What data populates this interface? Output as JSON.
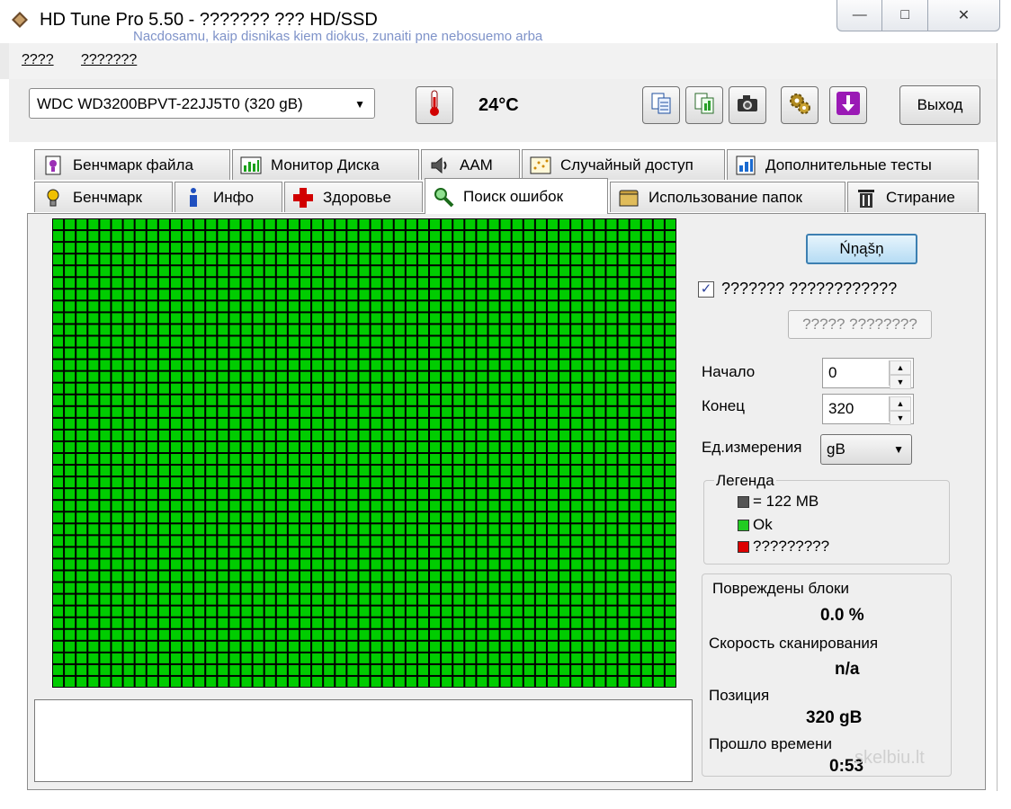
{
  "window": {
    "title": "HD Tune Pro 5.50 - ??????? ??? HD/SSD",
    "background_text": "Nacdosamu, kaip disnikas kiem diokus, zunaiti pne nebosuemo arba",
    "controls": {
      "minimize": "—",
      "maximize": "□",
      "close": "✕"
    }
  },
  "menu": {
    "items": [
      {
        "label": "????"
      },
      {
        "label": "???????"
      }
    ]
  },
  "toolbar": {
    "drive": "WDC WD3200BPVT-22JJ5T0 (320 gB)",
    "temperature": "24°C",
    "exit_label": "Выход",
    "icons": [
      "thermometer-icon",
      "copy-text-icon",
      "copy-info-icon",
      "screenshot-camera-icon",
      "options-gear-icon",
      "save-download-icon"
    ]
  },
  "tabs": {
    "row1": [
      {
        "label": "Бенчмарк файла",
        "icon": "file-benchmark-icon"
      },
      {
        "label": "Монитор Диска",
        "icon": "disk-monitor-icon"
      },
      {
        "label": "AAM",
        "icon": "speaker-icon"
      },
      {
        "label": "Случайный доступ",
        "icon": "random-access-icon"
      },
      {
        "label": "Дополнительные тесты",
        "icon": "extra-tests-icon"
      }
    ],
    "row2": [
      {
        "label": "Бенчмарк",
        "icon": "benchmark-icon"
      },
      {
        "label": "Инфо",
        "icon": "info-icon"
      },
      {
        "label": "Здоровье",
        "icon": "health-cross-icon"
      },
      {
        "label": "Поиск ошибок",
        "icon": "magnifier-icon",
        "active": true
      },
      {
        "label": "Использование папок",
        "icon": "folder-icon"
      },
      {
        "label": "Стирание",
        "icon": "trash-icon"
      }
    ]
  },
  "scan": {
    "start_label": "Ńņąšņ",
    "checkbox_label": "??????? ????????????",
    "checkbox_checked": true,
    "disabled_button_label": "????? ????????",
    "start_field": {
      "label": "Начало",
      "value": "0"
    },
    "end_field": {
      "label": "Конец",
      "value": "320"
    },
    "unit_field": {
      "label": "Ед.измерения",
      "value": "gB"
    },
    "grid": {
      "rows": 40,
      "cols": 53,
      "status": "ok",
      "block_color": "#00cc00",
      "line_color": "#000000"
    }
  },
  "legend": {
    "title": "Легенда",
    "items": [
      {
        "color": "#555555",
        "label": "= 122 MB"
      },
      {
        "color": "#22cc22",
        "label": "Ok"
      },
      {
        "color": "#dd0000",
        "label": "?????????"
      }
    ]
  },
  "stats": {
    "damaged": {
      "label": "Повреждены блоки",
      "value": "0.0 %"
    },
    "speed": {
      "label": "Скорость сканирования",
      "value": "n/a"
    },
    "position": {
      "label": "Позиция",
      "value": "320 gB"
    },
    "elapsed": {
      "label": "Прошло времени",
      "value": "0:53"
    }
  },
  "watermark": "skelbiu.lt"
}
